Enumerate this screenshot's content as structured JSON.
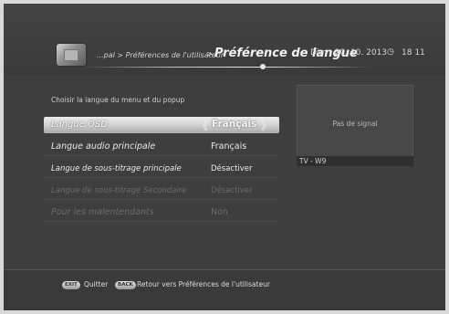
{
  "header": {
    "breadcrumb_path": "...pal > Préférences de l'utilisateur",
    "breadcrumb_sep": ">",
    "title": "Préférence de langue",
    "date": "Dim , 20. 10. 2013",
    "clock_icon": "clock-icon",
    "time": "18 11"
  },
  "main": {
    "instruction": "Choisir la langue du menu et du popup",
    "rows": [
      {
        "label": "Langue OSD",
        "value": "Français",
        "state": "selected"
      },
      {
        "label": "Langue audio principale",
        "value": "Français",
        "state": "normal"
      },
      {
        "label": "Langue de sous-titrage principale",
        "value": "Désactiver",
        "state": "normal"
      },
      {
        "label": "Langue de sous-titrage Secondaire",
        "value": "Désactiver",
        "state": "disabled"
      },
      {
        "label": "Pour les malentendants",
        "value": "Non",
        "state": "disabled"
      }
    ],
    "arrow_left": "《",
    "arrow_right": "》"
  },
  "preview": {
    "no_signal": "Pas de signal",
    "channel": "TV - W9"
  },
  "footer": {
    "exit_key": "EXIT",
    "exit_label": "Quitter",
    "back_key": "BACK",
    "back_label": "Retour vers Préférences de l'utilisateur"
  },
  "colors": {
    "background": "#3e3e3e",
    "selected_highlight": "#d5d5d5",
    "text": "#e8e8e8",
    "disabled_text": "#6b6b6b"
  }
}
